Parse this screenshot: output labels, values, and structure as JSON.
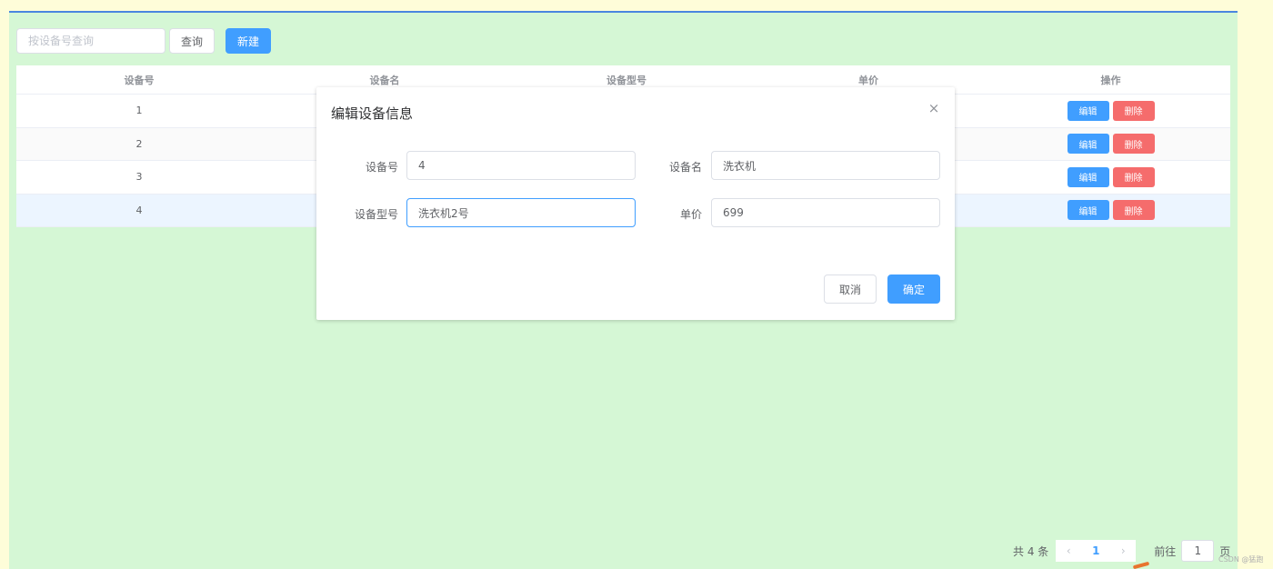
{
  "toolbar": {
    "search_placeholder": "按设备号查询",
    "search_value": "",
    "query_label": "查询",
    "new_label": "新建"
  },
  "table": {
    "headers": [
      "设备号",
      "设备名",
      "设备型号",
      "单价",
      "操作"
    ],
    "rows": [
      {
        "id": "1"
      },
      {
        "id": "2"
      },
      {
        "id": "3"
      },
      {
        "id": "4"
      }
    ],
    "edit_label": "编辑",
    "delete_label": "删除"
  },
  "pagination": {
    "total": "共 4 条",
    "prev_icon": "‹",
    "current_page": "1",
    "next_icon": "›",
    "goto_prefix": "前往",
    "goto_value": "1",
    "goto_suffix": "页"
  },
  "watermark": "CSDN @猛跑",
  "dialog": {
    "title": "编辑设备信息",
    "close_icon": "×",
    "fields": [
      {
        "label": "设备号",
        "value": "4"
      },
      {
        "label": "设备名",
        "value": "洗衣机"
      },
      {
        "label": "设备型号",
        "value": "洗衣机2号"
      },
      {
        "label": "单价",
        "value": "699"
      }
    ],
    "cancel_label": "取消",
    "ok_label": "确定"
  },
  "colors": {
    "accent": "#409eff",
    "danger": "#f56c6c",
    "app_bg": "#d5f7d5",
    "page_bg": "#fefdd9",
    "top_border": "#4a86e0"
  }
}
